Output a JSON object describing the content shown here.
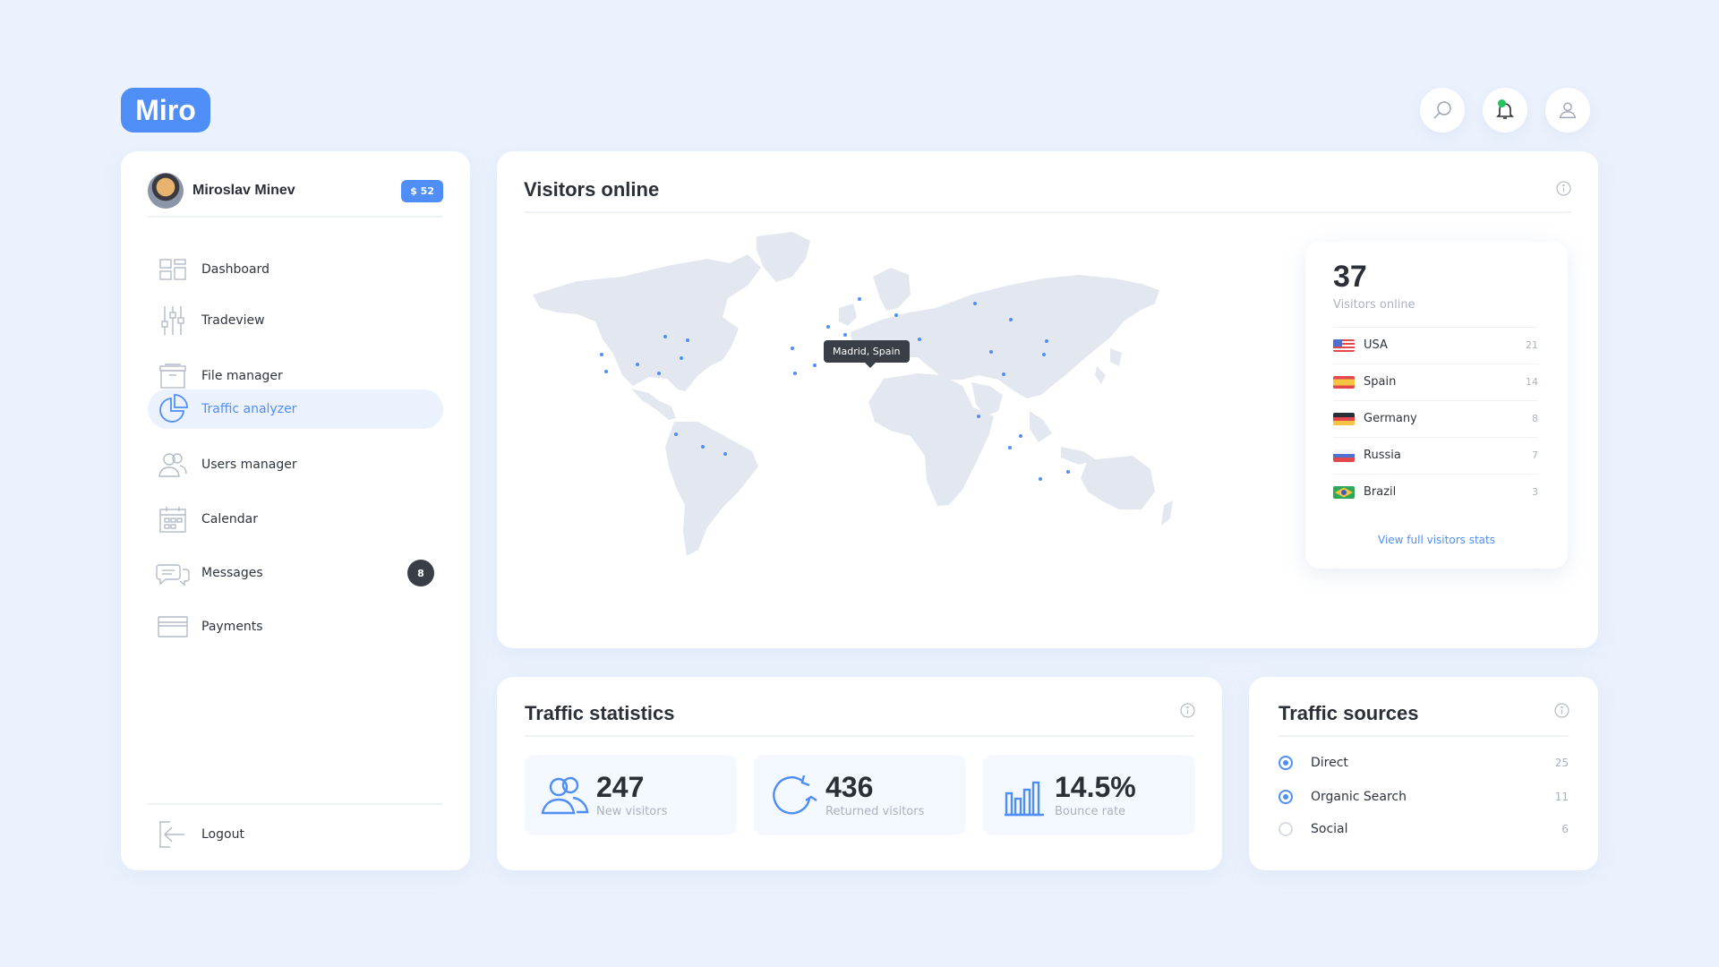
{
  "app": {
    "logo": "Miro"
  },
  "header": {
    "icons": [
      "search-icon",
      "bell-icon",
      "user-icon"
    ],
    "notification_dot_color": "#22c55e"
  },
  "profile": {
    "name": "Miroslav Minev",
    "balance": "$ 52"
  },
  "sidebar": {
    "items": [
      {
        "label": "Dashboard",
        "icon": "dashboard-icon"
      },
      {
        "label": "Tradeview",
        "icon": "sliders-icon"
      },
      {
        "label": "File manager",
        "icon": "archive-icon"
      },
      {
        "label": "Traffic analyzer",
        "icon": "pie-chart-icon",
        "active": true
      },
      {
        "label": "Users manager",
        "icon": "users-icon"
      },
      {
        "label": "Calendar",
        "icon": "calendar-icon"
      },
      {
        "label": "Messages",
        "icon": "chat-icon",
        "badge": "8"
      },
      {
        "label": "Payments",
        "icon": "credit-card-icon"
      }
    ],
    "logout": "Logout"
  },
  "visitors": {
    "title": "Visitors online",
    "tooltip": "Madrid, Spain",
    "count": "37",
    "count_label": "Visitors online",
    "countries": [
      {
        "name": "USA",
        "value": "21",
        "flag": "us-flag-icon"
      },
      {
        "name": "Spain",
        "value": "14",
        "flag": "es-flag-icon"
      },
      {
        "name": "Germany",
        "value": "8",
        "flag": "de-flag-icon"
      },
      {
        "name": "Russia",
        "value": "7",
        "flag": "ru-flag-icon"
      },
      {
        "name": "Brazil",
        "value": "3",
        "flag": "br-flag-icon"
      }
    ],
    "link": "View full visitors stats"
  },
  "traffic_stats": {
    "title": "Traffic statistics",
    "items": [
      {
        "value": "247",
        "label": "New visitors",
        "icon": "users-icon"
      },
      {
        "value": "436",
        "label": "Returned visitors",
        "icon": "refresh-icon"
      },
      {
        "value": "14.5%",
        "label": "Bounce rate",
        "icon": "bar-chart-icon"
      }
    ]
  },
  "traffic_sources": {
    "title": "Traffic sources",
    "items": [
      {
        "name": "Direct",
        "value": "25",
        "selected": true
      },
      {
        "name": "Organic Search",
        "value": "11",
        "selected": true
      },
      {
        "name": "Social",
        "value": "6",
        "selected": false
      }
    ]
  },
  "colors": {
    "accent": "#4f8ef7",
    "background": "#ebf2fd",
    "dark": "#3a3e47"
  }
}
